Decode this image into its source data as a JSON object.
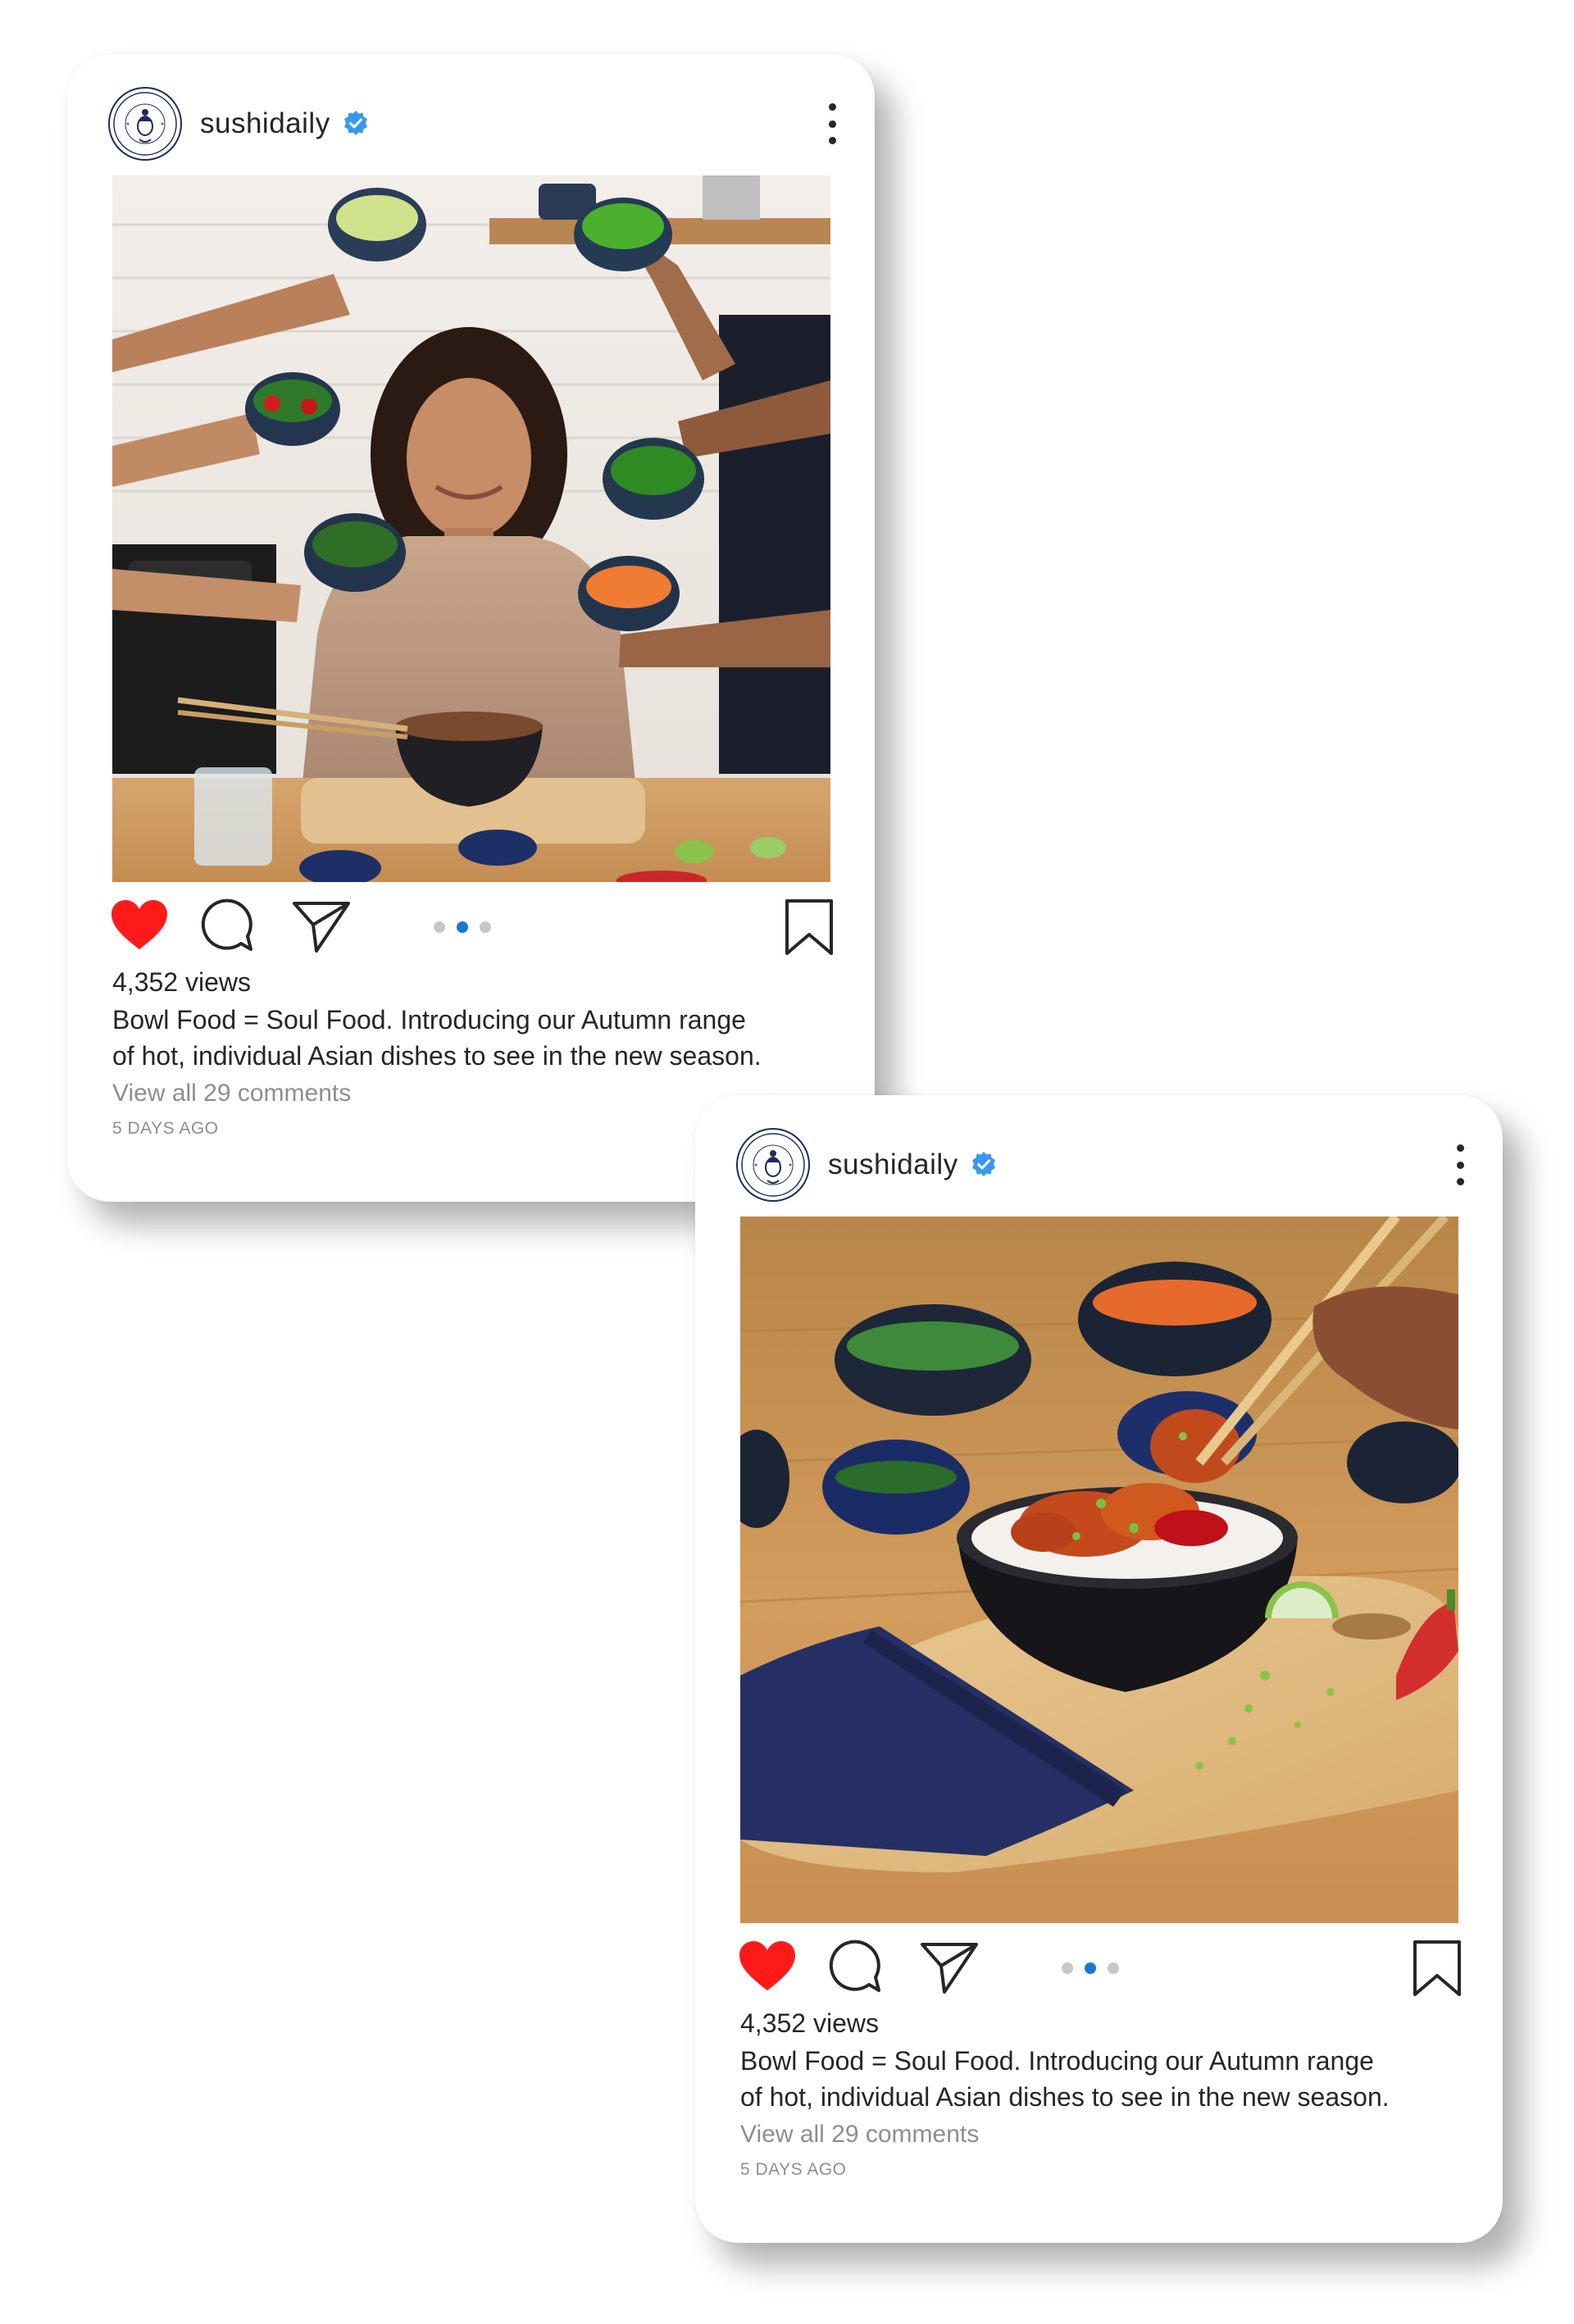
{
  "posts": [
    {
      "username": "sushidaily",
      "verified": true,
      "avatar_logo": "sushi-daily-logo",
      "image_description_icon": "photo-woman-with-bowls",
      "liked": true,
      "carousel_active_index": 1,
      "carousel_count": 3,
      "views": "4,352 views",
      "caption_line1": "Bowl Food = Soul Food. Introducing our Autumn range",
      "caption_line2": "of hot, individual Asian dishes to see in the new season.",
      "comments_link": "View all 29 comments",
      "timestamp": "5 DAYS AGO"
    },
    {
      "username": "sushidaily",
      "verified": true,
      "avatar_logo": "sushi-daily-logo",
      "image_description_icon": "photo-chicken-rice-bowl",
      "liked": true,
      "carousel_active_index": 1,
      "carousel_count": 3,
      "views": "4,352 views",
      "caption_line1": "Bowl Food = Soul Food. Introducing our Autumn range",
      "caption_line2": "of hot, individual Asian dishes to see in the new season.",
      "comments_link": "View all 29 comments",
      "timestamp": "5 DAYS AGO"
    }
  ],
  "colors": {
    "heart": "#ff1a1a",
    "verified": "#3897f0",
    "carousel_active": "#1877d4",
    "carousel_inactive": "#c7c7c7",
    "muted_text": "#8e8e8e",
    "logo_navy": "#1e2b5c"
  }
}
